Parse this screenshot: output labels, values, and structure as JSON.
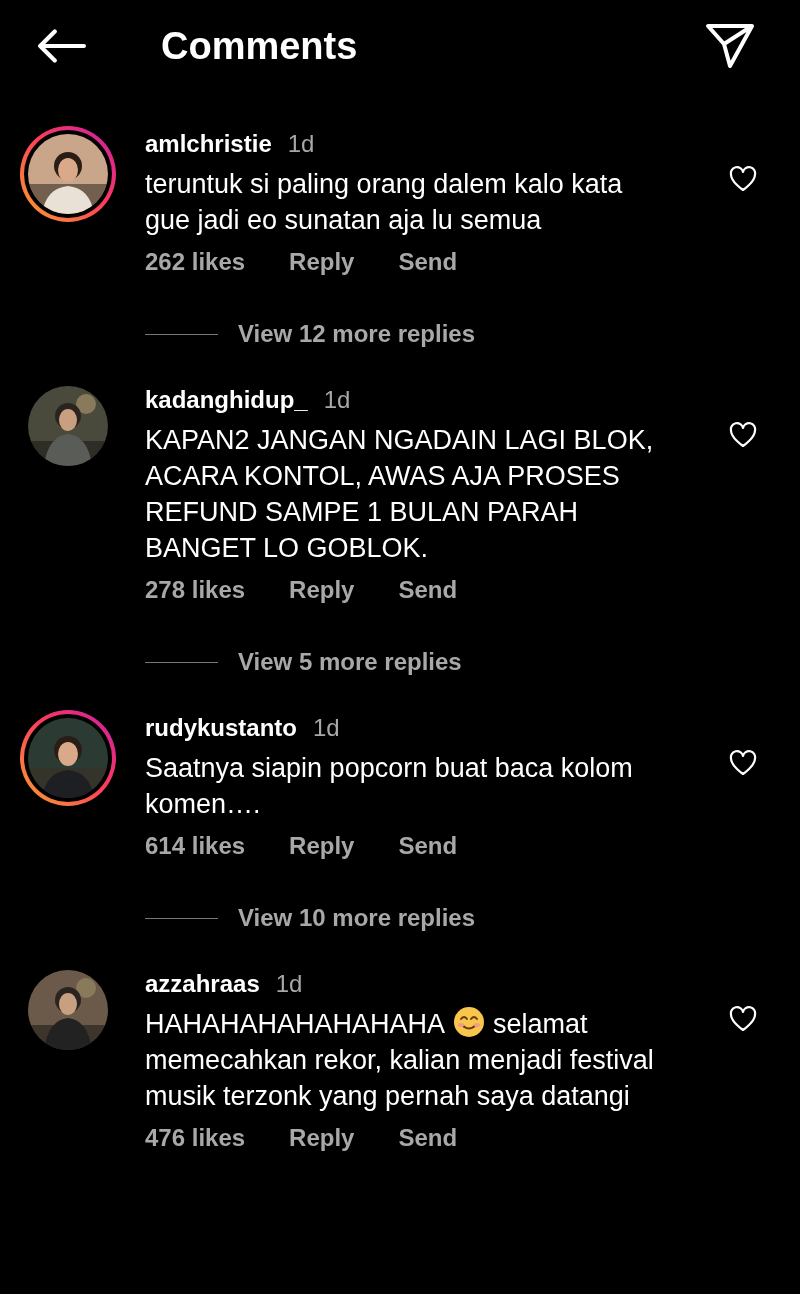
{
  "header": {
    "title": "Comments"
  },
  "comments": [
    {
      "username": "amlchristie",
      "time": "1d",
      "story": true,
      "parts": [
        {
          "kind": "block",
          "text": "teruntuk si paling orang dalem kalo kata gue jadi eo sunatan aja lu semua"
        }
      ],
      "likes": "262 likes",
      "reply": "Reply",
      "send": "Send",
      "more_replies": "View 12 more replies"
    },
    {
      "username": "kadanghidup_",
      "time": "1d",
      "story": false,
      "parts": [
        {
          "kind": "block",
          "text": "KAPAN2 JANGAN NGADAIN LAGI BLOK, ACARA KONTOL, AWAS AJA PROSES REFUND SAMPE 1 BULAN PARAH BANGET LO GOBLOK."
        }
      ],
      "likes": "278 likes",
      "reply": "Reply",
      "send": "Send",
      "more_replies": "View 5 more replies"
    },
    {
      "username": "rudykustanto",
      "time": "1d",
      "story": true,
      "parts": [
        {
          "kind": "block",
          "text": "Saatnya siapin popcorn buat baca kolom komen…."
        }
      ],
      "likes": "614 likes",
      "reply": "Reply",
      "send": "Send",
      "more_replies": "View 10 more replies"
    },
    {
      "username": "azzahraas",
      "time": "1d",
      "story": false,
      "parts": [
        {
          "kind": "text",
          "text": "HAHAHAHAHAHAHAHA"
        },
        {
          "kind": "emoji"
        },
        {
          "kind": "text",
          "text": "selamat"
        },
        {
          "kind": "block",
          "text": "memecahkan rekor, kalian menjadi festival musik terzonk yang pernah saya datangi"
        }
      ],
      "likes": "476 likes",
      "reply": "Reply",
      "send": "Send"
    }
  ]
}
